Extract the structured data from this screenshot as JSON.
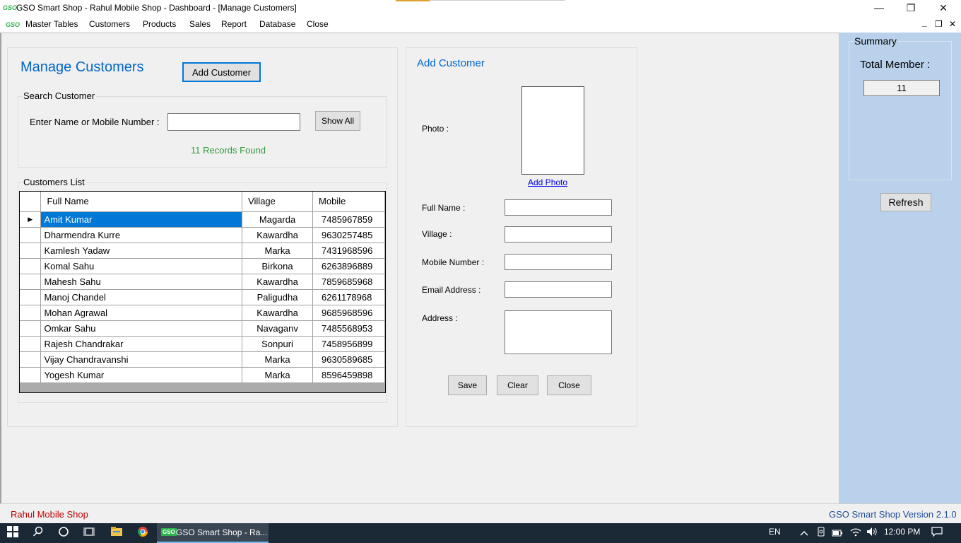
{
  "window": {
    "logo": "GSO",
    "title": "GSO Smart Shop - Rahul Mobile Shop - Dashboard - [Manage Customers]",
    "minimize": "—",
    "maximize": "❐",
    "close": "✕"
  },
  "menu": {
    "logo": "GSO",
    "items": [
      "Master Tables",
      "Customers",
      "Products",
      "Sales",
      "Report",
      "Database",
      "Close"
    ],
    "mdi_minimize": "_",
    "mdi_restore": "❐",
    "mdi_close": "✕"
  },
  "manage": {
    "title": "Manage Customers",
    "add_button": "Add Customer",
    "search_group": "Search Customer",
    "search_label": "Enter Name or Mobile Number :",
    "search_value": "",
    "show_all": "Show All",
    "records_found": "11 Records Found",
    "list_group": "Customers List"
  },
  "grid": {
    "columns": [
      "Full Name",
      "Village",
      "Mobile"
    ],
    "row_indicator": "▶",
    "rows": [
      {
        "name": "Amit Kumar",
        "village": "Magarda",
        "mobile": "7485967859"
      },
      {
        "name": "Dharmendra Kurre",
        "village": "Kawardha",
        "mobile": "9630257485"
      },
      {
        "name": "Kamlesh Yadaw",
        "village": "Marka",
        "mobile": "7431968596"
      },
      {
        "name": "Komal Sahu",
        "village": "Birkona",
        "mobile": "6263896889"
      },
      {
        "name": "Mahesh Sahu",
        "village": "Kawardha",
        "mobile": "7859685968"
      },
      {
        "name": "Manoj Chandel",
        "village": "Paligudha",
        "mobile": "6261178968"
      },
      {
        "name": "Mohan Agrawal",
        "village": "Kawardha",
        "mobile": "9685968596"
      },
      {
        "name": "Omkar Sahu",
        "village": "Navaganv",
        "mobile": "7485568953"
      },
      {
        "name": "Rajesh Chandrakar",
        "village": "Sonpuri",
        "mobile": "7458956899"
      },
      {
        "name": "Vijay Chandravanshi",
        "village": "Marka",
        "mobile": "9630589685"
      },
      {
        "name": "Yogesh Kumar",
        "village": "Marka",
        "mobile": "8596459898"
      }
    ]
  },
  "form": {
    "title": "Add Customer",
    "photo_label": "Photo :",
    "add_photo": "Add Photo",
    "full_name_label": "Full Name :",
    "village_label": "Village :",
    "mobile_label": "Mobile Number :",
    "email_label": "Email Address :",
    "address_label": "Address :",
    "save": "Save",
    "clear": "Clear",
    "close": "Close"
  },
  "summary": {
    "title": "Summary",
    "total_label": "Total Member :",
    "total_value": "11",
    "refresh": "Refresh"
  },
  "status": {
    "left": "Rahul Mobile Shop",
    "right": "GSO Smart Shop Version 2.1.0"
  },
  "taskbar": {
    "app_label": "GSO Smart Shop - Ra...",
    "lang": "EN",
    "time": "12:00 PM"
  },
  "colors": {
    "accent_blue": "#0066cc",
    "selection": "#0078d7",
    "records_green": "#2e9b3b",
    "status_red": "#c00000",
    "status_blue": "#1f4e99",
    "side_panel": "#b9d1ea"
  }
}
